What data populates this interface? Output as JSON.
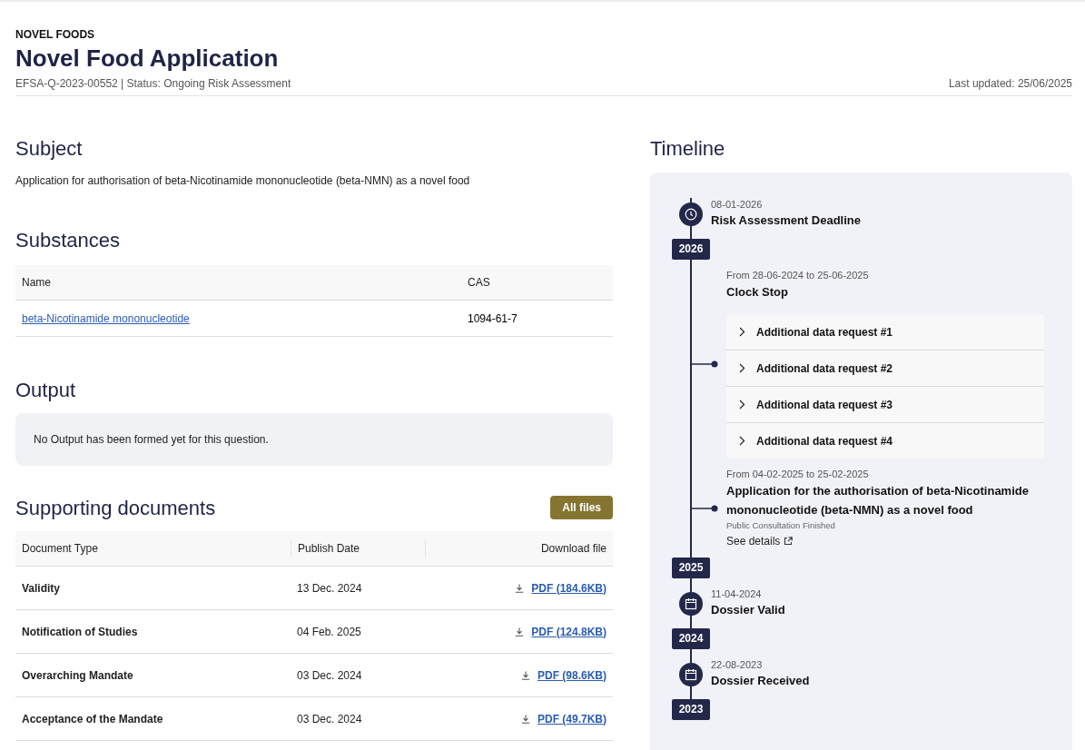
{
  "header": {
    "category": "NOVEL FOODS",
    "title": "Novel Food Application",
    "meta": "EFSA-Q-2023-00552 | Status: Ongoing Risk Assessment",
    "last_updated": "Last updated: 25/06/2025"
  },
  "subject": {
    "heading": "Subject",
    "text": "Application for authorisation of beta-Nicotinamide mononucleotide (beta-NMN) as a novel food"
  },
  "substances": {
    "heading": "Substances",
    "columns": [
      "Name",
      "CAS"
    ],
    "rows": [
      {
        "name": "beta-Nicotinamide mononucleotide",
        "cas": "1094-61-7"
      }
    ]
  },
  "output": {
    "heading": "Output",
    "message": "No Output has been formed yet for this question."
  },
  "documents": {
    "heading": "Supporting documents",
    "button": "All files",
    "columns": [
      "Document Type",
      "Publish Date",
      "Download file"
    ],
    "rows": [
      {
        "type": "Validity",
        "date": "13 Dec. 2024",
        "file": "PDF (184.6KB)"
      },
      {
        "type": "Notification of Studies",
        "date": "04 Feb. 2025",
        "file": "PDF (124.8KB)"
      },
      {
        "type": "Overarching Mandate",
        "date": "03 Dec. 2024",
        "file": "PDF (98.6KB)"
      },
      {
        "type": "Acceptance of the Mandate",
        "date": "03 Dec. 2024",
        "file": "PDF (49.7KB)"
      }
    ]
  },
  "timeline": {
    "heading": "Timeline",
    "items": [
      {
        "kind": "deadline",
        "date": "08-01-2026",
        "title": "Risk Assessment Deadline"
      },
      {
        "kind": "year",
        "label": "2026"
      },
      {
        "kind": "period",
        "range": "From 28-06-2024 to 25-06-2025",
        "title": "Clock Stop",
        "requests": [
          {
            "label": "Additional data request #1",
            "expanded": false
          },
          {
            "label": "Additional data request #2",
            "expanded": false
          },
          {
            "label": "Additional data request #3",
            "expanded": false
          },
          {
            "label": "Additional data request #4",
            "expanded": false
          }
        ]
      },
      {
        "kind": "period",
        "range": "From 04-02-2025 to 25-02-2025",
        "title": "Application for the authorisation of beta-Nicotinamide mononucleotide (beta-NMN) as a novel food",
        "status": "Public Consultation Finished",
        "link": "See details"
      },
      {
        "kind": "year",
        "label": "2025"
      },
      {
        "kind": "milestone",
        "date": "11-04-2024",
        "title": "Dossier Valid"
      },
      {
        "kind": "year",
        "label": "2024"
      },
      {
        "kind": "milestone",
        "date": "22-08-2023",
        "title": "Dossier Received"
      },
      {
        "kind": "year",
        "label": "2023"
      }
    ]
  }
}
